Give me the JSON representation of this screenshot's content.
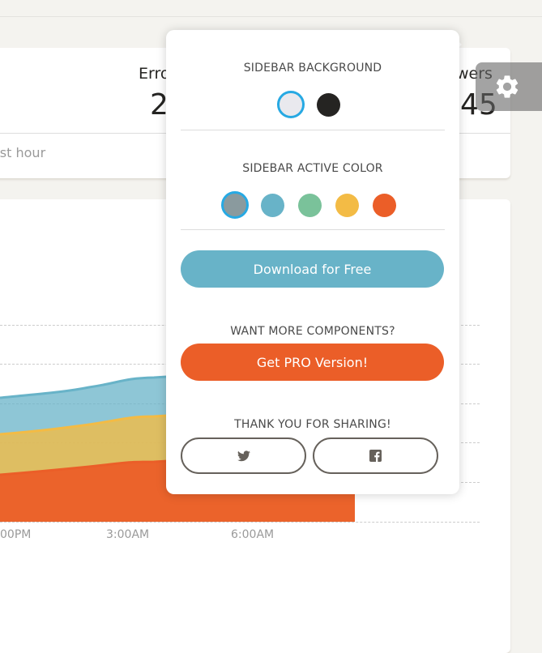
{
  "stats_card": {
    "label_partial": "Erro",
    "value_partial": "2",
    "right_label_partial": "wers",
    "right_value_partial": "45",
    "footer_partial": "ast hour"
  },
  "chart_data": {
    "type": "area",
    "categories": [
      "00PM",
      "3:00AM",
      "6:00AM"
    ],
    "series": [
      {
        "color": "#68b3c8"
      },
      {
        "color": "#f3bb45"
      },
      {
        "color": "#eb5e28"
      }
    ]
  },
  "settings": {
    "gear_icon": "gear-icon",
    "sidebar_background": {
      "title": "SIDEBAR BACKGROUND",
      "options": [
        "#e9e9ee",
        "#252422"
      ],
      "selected": 0
    },
    "sidebar_active_color": {
      "title": "SIDEBAR ACTIVE COLOR",
      "options": [
        "#8a9a9e",
        "#68b3c8",
        "#7ac29a",
        "#f3bb45",
        "#eb5e28"
      ],
      "selected": 0
    },
    "download_button": "Download for Free",
    "more_components_title": "WANT MORE COMPONENTS?",
    "pro_button": "Get PRO Version!",
    "sharing_title": "THANK YOU FOR SHARING!",
    "share_buttons": [
      "twitter-icon",
      "facebook-icon"
    ],
    "colors": {
      "download": "#68b3c8",
      "pro": "#eb5e28",
      "selected_ring": "#27a9e3"
    }
  }
}
